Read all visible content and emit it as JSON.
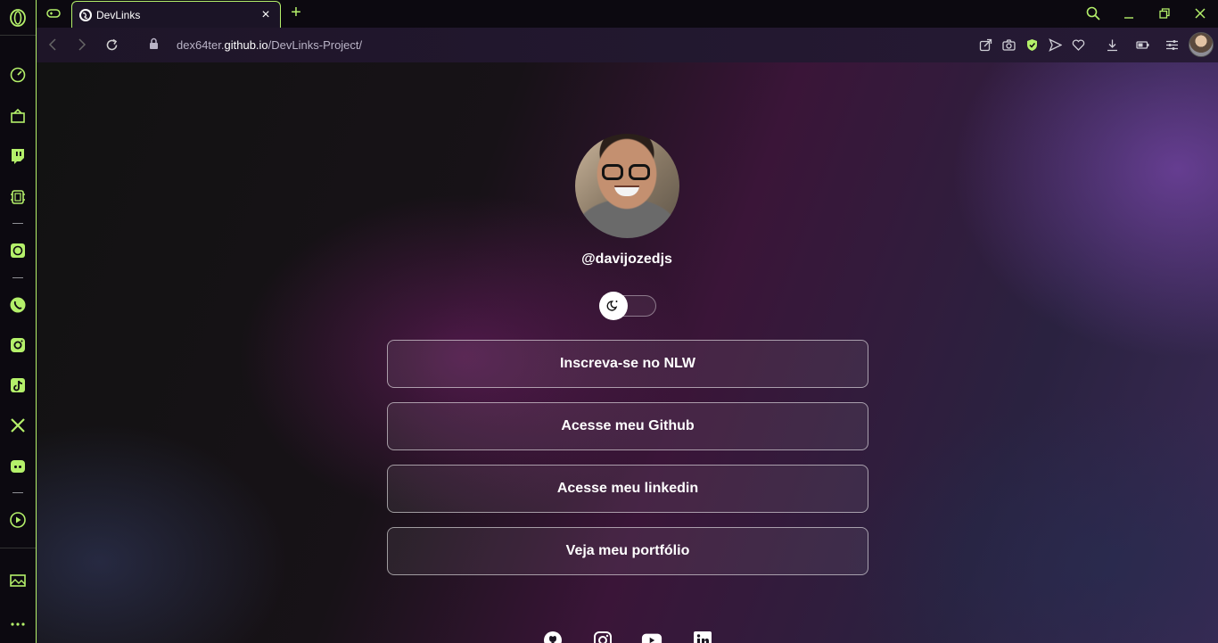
{
  "browser": {
    "tab": {
      "title": "DevLinks"
    },
    "url": {
      "host_prefix": "dex64ter.",
      "host_main": "github.io",
      "path": "/DevLinks-Project/"
    }
  },
  "sidebar": {
    "items": [
      "speed-dial-icon",
      "shopping-icon",
      "twitch-icon",
      "crypto-wallet-icon",
      "chatgpt-icon",
      "whatsapp-icon",
      "instagram-icon",
      "tiktok-icon",
      "x-icon",
      "discord-icon",
      "player-icon",
      "gallery-icon",
      "more-icon"
    ]
  },
  "page": {
    "username": "@davijozedjs",
    "links": [
      {
        "label": "Inscreva-se no NLW"
      },
      {
        "label": "Acesse meu Github"
      },
      {
        "label": "Acesse meu linkedin"
      },
      {
        "label": "Veja meu portfólio"
      }
    ],
    "socials": [
      "github-icon",
      "instagram-icon",
      "youtube-icon",
      "linkedin-icon"
    ],
    "theme": {
      "accent": "#b4f06a",
      "text": "#ffffff"
    }
  }
}
